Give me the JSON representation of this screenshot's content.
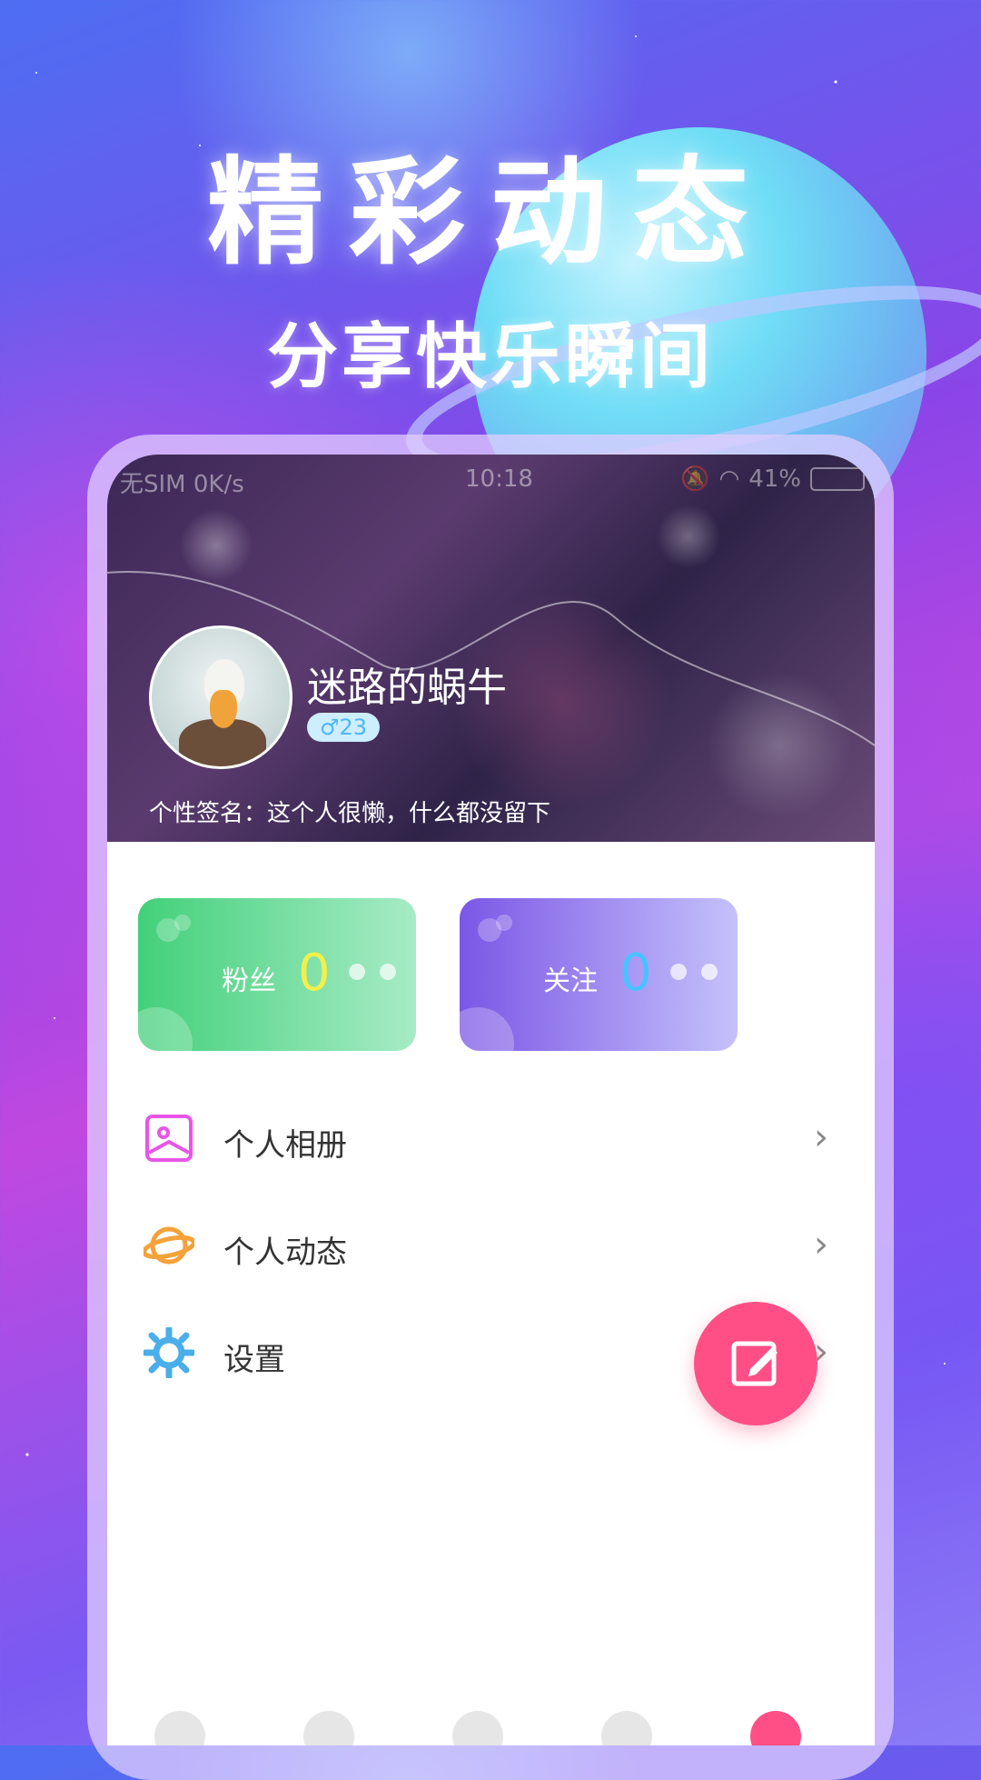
{
  "banner": {
    "headline": "精彩动态",
    "subheadline": "分享快乐瞬间"
  },
  "statusbar": {
    "left": "无SIM 0K/s",
    "time": "10:18",
    "battery": "41%"
  },
  "profile": {
    "username": "迷路的蜗牛",
    "gender_age": "♂23",
    "signature": "个性签名：这个人很懒，什么都没留下"
  },
  "stats": {
    "fans": {
      "label": "粉丝",
      "count": "0"
    },
    "follow": {
      "label": "关注",
      "count": "0"
    }
  },
  "menu": {
    "items": [
      {
        "label": "个人相册",
        "icon": "album-icon"
      },
      {
        "label": "个人动态",
        "icon": "planet-icon"
      },
      {
        "label": "设置",
        "icon": "gear-icon"
      }
    ]
  },
  "colors": {
    "fab": "#ff4f86",
    "fans_card": "#43d07a",
    "follow_card": "#7b57e6",
    "album_icon": "#e855e8",
    "planet_icon": "#f4a23a",
    "gear_icon": "#4aaeea"
  }
}
